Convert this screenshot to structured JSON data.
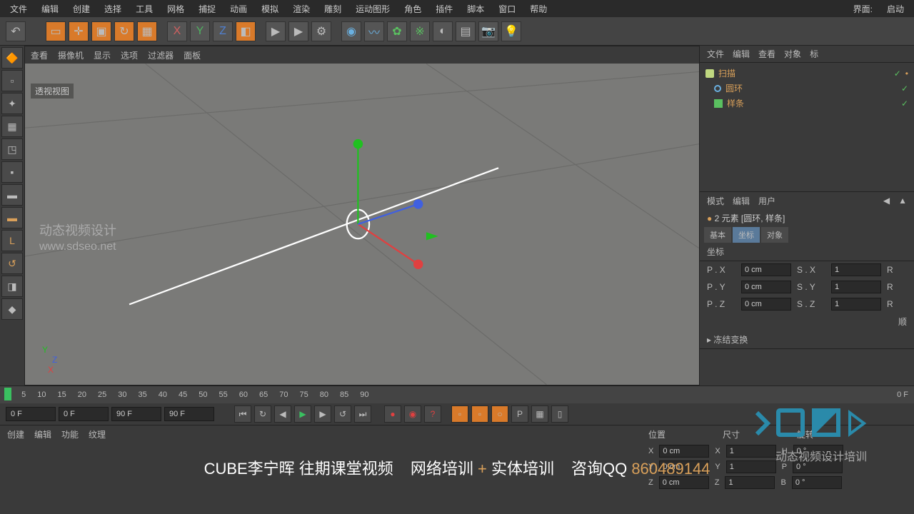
{
  "interface": {
    "label": "界面:",
    "value": "启动"
  },
  "menu": [
    "文件",
    "编辑",
    "创建",
    "选择",
    "工具",
    "网格",
    "捕捉",
    "动画",
    "模拟",
    "渲染",
    "雕刻",
    "运动图形",
    "角色",
    "插件",
    "脚本",
    "窗口",
    "帮助"
  ],
  "viewport_menu": [
    "查看",
    "摄像机",
    "显示",
    "选项",
    "过滤器",
    "面板"
  ],
  "viewport_label": "透视视图",
  "watermark": {
    "line1": "动态视频设计",
    "line2": "www.sdseo.net"
  },
  "axis": {
    "x": "X",
    "y": "Y",
    "z": "Z"
  },
  "obj_panel_tabs": [
    "文件",
    "编辑",
    "查看",
    "对象",
    "标"
  ],
  "objects": [
    {
      "name": "扫描",
      "icon": "sweep"
    },
    {
      "name": "圆环",
      "icon": "circle"
    },
    {
      "name": "样条",
      "icon": "spline"
    }
  ],
  "attr_panel_tabs": [
    "模式",
    "编辑",
    "用户"
  ],
  "attr_title": "2 元素 [圆环, 样条]",
  "attr_sub_tabs": [
    "基本",
    "坐标",
    "对象"
  ],
  "attr_active_tab": 1,
  "attr_section": "坐标",
  "coords": {
    "px": {
      "label": "P . X",
      "value": "0 cm"
    },
    "py": {
      "label": "P . Y",
      "value": "0 cm"
    },
    "pz": {
      "label": "P . Z",
      "value": "0 cm"
    },
    "sx": {
      "label": "S . X",
      "value": "1"
    },
    "sy": {
      "label": "S . Y",
      "value": "1"
    },
    "sz": {
      "label": "S . Z",
      "value": "1"
    },
    "r": "R"
  },
  "freeze": "冻结变换",
  "align": "顺",
  "timeline": {
    "ticks": [
      "0",
      "5",
      "10",
      "15",
      "20",
      "25",
      "30",
      "35",
      "40",
      "45",
      "50",
      "55",
      "60",
      "65",
      "70",
      "75",
      "80",
      "85",
      "90"
    ],
    "current": "0 F",
    "start": "0 F",
    "end": "90 F",
    "range_end": "90 F"
  },
  "bottom_tabs": [
    "创建",
    "编辑",
    "功能",
    "纹理"
  ],
  "psr": {
    "headers": [
      "位置",
      "尺寸",
      "旋转"
    ],
    "rows": [
      {
        "axis": "X",
        "pos": "0 cm",
        "saxis": "X",
        "size": "1",
        "raxis": "H",
        "rot": "0 °"
      },
      {
        "axis": "Y",
        "pos": "0 cm",
        "saxis": "Y",
        "size": "1",
        "raxis": "P",
        "rot": "0 °"
      },
      {
        "axis": "Z",
        "pos": "0 cm",
        "saxis": "Z",
        "size": "1",
        "raxis": "B",
        "rot": "0 °"
      }
    ]
  },
  "cube_logo": {
    "big": "CU▮E",
    "sub": "动态视频设计培训"
  },
  "footer": {
    "left": "CUBE李宁晖 往期课堂视频",
    "mid1": "网络培训",
    "plus": "+",
    "mid2": "实体培训",
    "right1": "咨询QQ",
    "qq": "860489144"
  }
}
